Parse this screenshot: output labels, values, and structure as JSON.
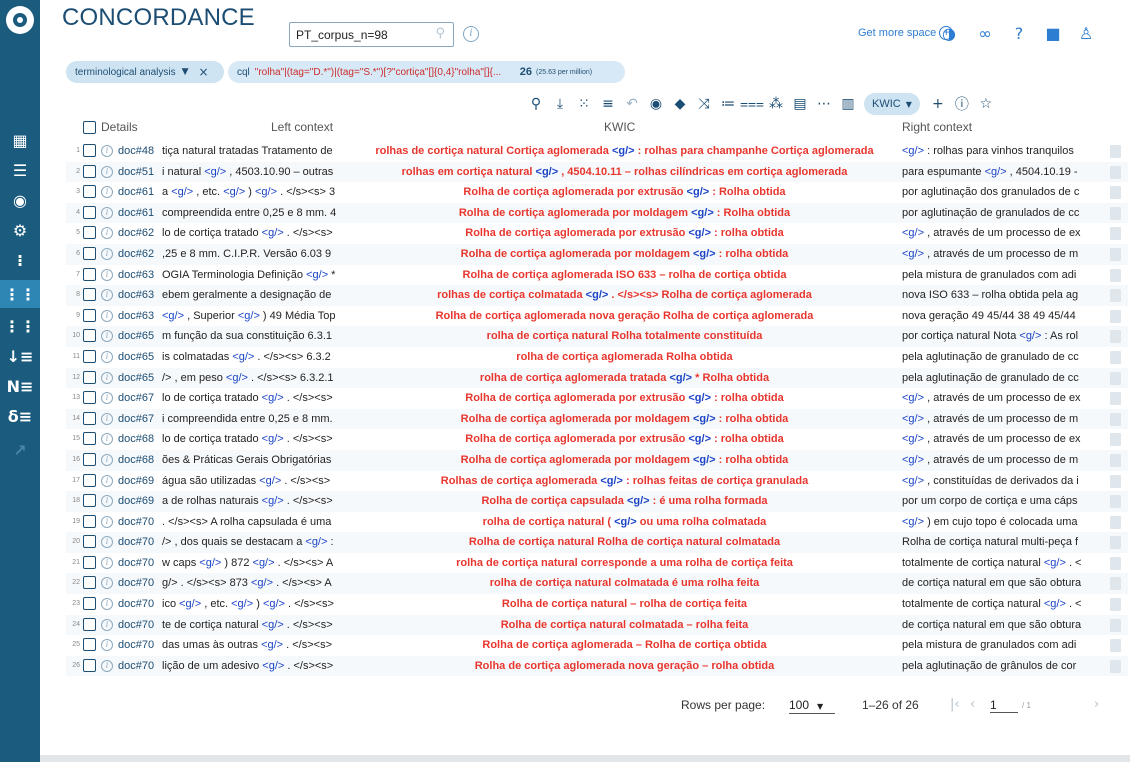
{
  "app": {
    "title": "CONCORDANCE",
    "corpus_value": "PT_corpus_n=98",
    "get_more_space": "Get more space",
    "plus_glyph": "+"
  },
  "sidebar": {
    "icons": [
      "dashboard-icon",
      "list-icon",
      "target-icon",
      "settings-icon",
      "bullet-list-icon",
      "concordance-icon",
      "grid-icon",
      "sort-icon",
      "ngram-icon",
      "keyword-icon",
      "trend-icon"
    ]
  },
  "chips": {
    "subcorpus": "terminological analysis",
    "query_label": "cql",
    "query_text": "\"rolha\"|(tag=\"D.*\")|(tag=\"S.*\")[?\"cortiça\"[]{0,4}\"rolha\"[]{...",
    "hit_count": "26",
    "per_million": "(25.63 per million)"
  },
  "toolbar": {
    "view_mode": "KWIC"
  },
  "table": {
    "headers": {
      "details": "Details",
      "left": "Left context",
      "kwic": "KWIC",
      "right": "Right context"
    },
    "rows": [
      {
        "n": "1",
        "doc": "doc#48",
        "left": "tiça natural tratadas Tratamento de",
        "kwic": "rolhas de cortiça natural Cortiça aglomerada <g/> : rolhas para champanhe Cortiça aglomerada",
        "right": "<g/> : rolhas para vinhos tranquilos"
      },
      {
        "n": "2",
        "doc": "doc#51",
        "left": "i natural <g/> , 4503.10.90 – outras",
        "kwic": "rolhas em cortiça natural <g/> , 4504.10.11 – rolhas cilíndricas em cortiça aglomerada",
        "right": "para espumante <g/> , 4504.10.19 -"
      },
      {
        "n": "3",
        "doc": "doc#61",
        "left": "a <g/> , etc. <g/> ) <g/> . </s><s> 3",
        "kwic": "Rolha de cortiça aglomerada por extrusão <g/> : Rolha obtida",
        "right": "por aglutinação dos granulados de c"
      },
      {
        "n": "4",
        "doc": "doc#61",
        "left": "compreendida entre 0,25 e 8 mm. 4",
        "kwic": "Rolha de cortiça aglomerada por moldagem <g/> : Rolha obtida",
        "right": "por aglutinação de granulados de cc"
      },
      {
        "n": "5",
        "doc": "doc#62",
        "left": "lo de cortiça tratado <g/> . </s><s>",
        "kwic": "Rolha de cortiça aglomerada por extrusão <g/> : rolha obtida",
        "right": "<g/> , através de um processo de ex"
      },
      {
        "n": "6",
        "doc": "doc#62",
        "left": ",25 e 8 mm. C.I.P.R. Versão 6.03 9",
        "kwic": "Rolha de cortiça aglomerada por moldagem <g/> : rolha obtida",
        "right": "<g/> , através de um processo de m"
      },
      {
        "n": "7",
        "doc": "doc#63",
        "left": "OGIA Terminologia Definição <g/> *",
        "kwic": "Rolha de cortiça aglomerada ISO 633 – rolha de cortiça obtida",
        "right": "pela mistura de granulados com adi"
      },
      {
        "n": "8",
        "doc": "doc#63",
        "left": "ebem geralmente a designação de",
        "kwic": "rolhas de cortiça colmatada <g/> . </s><s> Rolha de cortiça aglomerada",
        "right": "nova ISO 633 – rolha obtida pela ag"
      },
      {
        "n": "9",
        "doc": "doc#63",
        "left": "<g/> , Superior <g/> ) 49 Média Top",
        "kwic": "Rolha de cortiça aglomerada nova geração Rolha de cortiça aglomerada",
        "right": "nova geração 49 45/44 38 49 45/44"
      },
      {
        "n": "10",
        "doc": "doc#65",
        "left": "m função da sua constituição 6.3.1",
        "kwic": "rolha de cortiça natural Rolha totalmente constituída",
        "right": "por cortiça natural Nota <g/> : As rol"
      },
      {
        "n": "11",
        "doc": "doc#65",
        "left": "is colmatadas <g/> . </s><s> 6.3.2",
        "kwic": "rolha de cortiça aglomerada Rolha obtida",
        "right": "pela aglutinação de granulado de cc"
      },
      {
        "n": "12",
        "doc": "doc#65",
        "left": "/> , em peso <g/> . </s><s> 6.3.2.1",
        "kwic": "rolha de cortiça aglomerada tratada <g/> * Rolha obtida",
        "right": "pela aglutinação de granulado de cc"
      },
      {
        "n": "13",
        "doc": "doc#67",
        "left": "lo de cortiça tratado <g/> . </s><s>",
        "kwic": "Rolha de cortiça aglomerada por extrusão <g/> : rolha obtida",
        "right": "<g/> , através de um processo de ex"
      },
      {
        "n": "14",
        "doc": "doc#67",
        "left": "i compreendida entre 0,25 e 8 mm.",
        "kwic": "Rolha de cortiça aglomerada por moldagem <g/> : rolha obtida",
        "right": "<g/> , através de um processo de m"
      },
      {
        "n": "15",
        "doc": "doc#68",
        "left": "lo de cortiça tratado <g/> . </s><s>",
        "kwic": "Rolha de cortiça aglomerada por extrusão <g/> : rolha obtida",
        "right": "<g/> , através de um processo de ex"
      },
      {
        "n": "16",
        "doc": "doc#68",
        "left": "ões & Práticas Gerais Obrigatórias",
        "kwic": "Rolha de cortiça aglomerada por moldagem <g/> : rolha obtida",
        "right": "<g/> , através de um processo de m"
      },
      {
        "n": "17",
        "doc": "doc#69",
        "left": "água são utilizadas <g/> . </s><s>",
        "kwic": "Rolhas de cortiça aglomerada <g/> : rolhas feitas de cortiça granulada",
        "right": "<g/> , constituídas de derivados da i"
      },
      {
        "n": "18",
        "doc": "doc#69",
        "left": "a de rolhas naturais <g/> . </s><s>",
        "kwic": "Rolha de cortiça capsulada <g/> : é uma rolha formada",
        "right": "por um corpo de cortiça e uma cáps"
      },
      {
        "n": "19",
        "doc": "doc#70",
        "left": ". </s><s> A rolha capsulada é uma",
        "kwic": "rolha de cortiça natural ( <g/> ou uma rolha colmatada",
        "right": "<g/> ) em cujo topo é colocada uma"
      },
      {
        "n": "20",
        "doc": "doc#70",
        "left": "/> , dos quais se destacam a <g/> :",
        "kwic": "Rolha de cortiça natural Rolha de cortiça natural colmatada",
        "right": "Rolha de cortiça natural multi-peça f"
      },
      {
        "n": "21",
        "doc": "doc#70",
        "left": "w caps <g/> ) 872 <g/> . </s><s> A",
        "kwic": "rolha de cortiça natural corresponde a uma rolha de cortiça feita",
        "right": "totalmente de cortiça natural <g/> . <"
      },
      {
        "n": "22",
        "doc": "doc#70",
        "left": "g/> . </s><s> 873 <g/> . </s><s> A",
        "kwic": "rolha de cortiça natural colmatada é uma rolha feita",
        "right": "de cortiça natural em que são obtura"
      },
      {
        "n": "23",
        "doc": "doc#70",
        "left": "ico <g/> , etc. <g/> ) <g/> . </s><s>",
        "kwic": "Rolha de cortiça natural – rolha de cortiça feita",
        "right": "totalmente de cortiça natural <g/> . <"
      },
      {
        "n": "24",
        "doc": "doc#70",
        "left": "te de cortiça natural <g/> . </s><s>",
        "kwic": "Rolha de cortiça natural colmatada – rolha feita",
        "right": "de cortiça natural em que são obtura"
      },
      {
        "n": "25",
        "doc": "doc#70",
        "left": "das umas às outras <g/> . </s><s>",
        "kwic": "Rolha de cortiça aglomerada – Rolha de cortiça obtida",
        "right": "pela mistura de granulados com adi"
      },
      {
        "n": "26",
        "doc": "doc#70",
        "left": "lição de um adesivo <g/> . </s><s>",
        "kwic": "Rolha de cortiça aglomerada nova geração – rolha obtida",
        "right": "pela aglutinação de grânulos de cor"
      }
    ]
  },
  "pagination": {
    "rows_per_page_label": "Rows per page:",
    "rows_per_page": "100",
    "range": "1–26 of 26",
    "page": "1",
    "of_pages": "/ 1"
  }
}
